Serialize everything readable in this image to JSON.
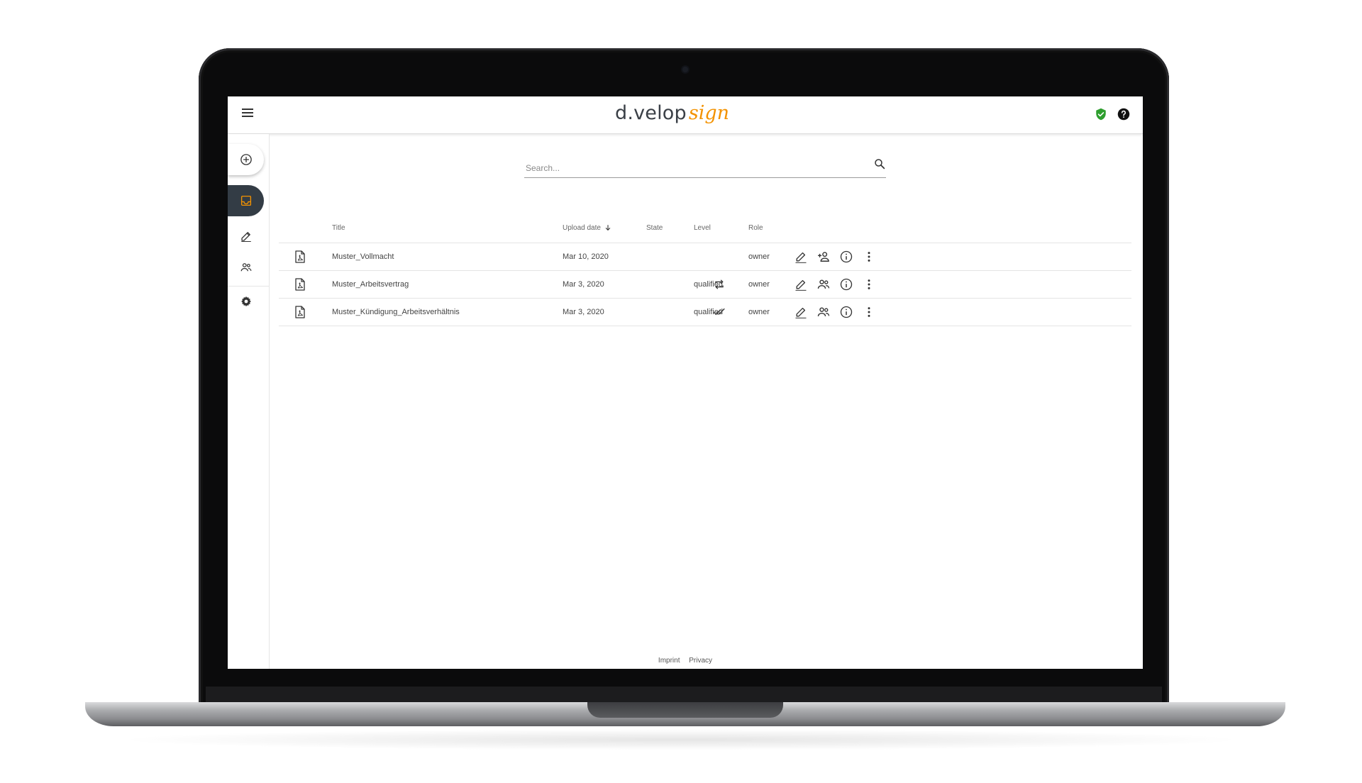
{
  "brand": {
    "name": "d.velop",
    "product": "sign",
    "accent_color": "#f39200",
    "dark_color": "#333c45"
  },
  "header": {
    "icons": [
      "menu-icon",
      "shield-check-icon",
      "help-icon"
    ],
    "shield_color": "#2e9e2e"
  },
  "sidebar": {
    "items": [
      {
        "icon": "add-circle-icon"
      },
      {
        "icon": "inbox-icon",
        "active": true
      },
      {
        "icon": "edit-icon"
      },
      {
        "icon": "people-icon"
      },
      {
        "icon": "settings-icon"
      }
    ]
  },
  "search": {
    "placeholder": "Search..."
  },
  "table": {
    "columns": [
      "Title",
      "Upload date",
      "State",
      "Level",
      "Role"
    ],
    "sort": {
      "column": "Upload date",
      "direction": "descending"
    },
    "rows": [
      {
        "title": "Muster_Vollmacht",
        "date": "Mar 10, 2020",
        "state": "",
        "level": "",
        "role": "owner",
        "share_icon": "person-add-icon"
      },
      {
        "title": "Muster_Arbeitsvertrag",
        "date": "Mar 3, 2020",
        "state": "repeat-icon",
        "level": "qualified",
        "role": "owner",
        "share_icon": "people-icon"
      },
      {
        "title": "Muster_Kündigung_Arbeitsverhältnis",
        "date": "Mar 3, 2020",
        "state": "done-all-icon",
        "level": "qualified",
        "role": "owner",
        "share_icon": "people-icon"
      }
    ]
  },
  "footer": {
    "links": [
      "Imprint",
      "Privacy"
    ]
  }
}
